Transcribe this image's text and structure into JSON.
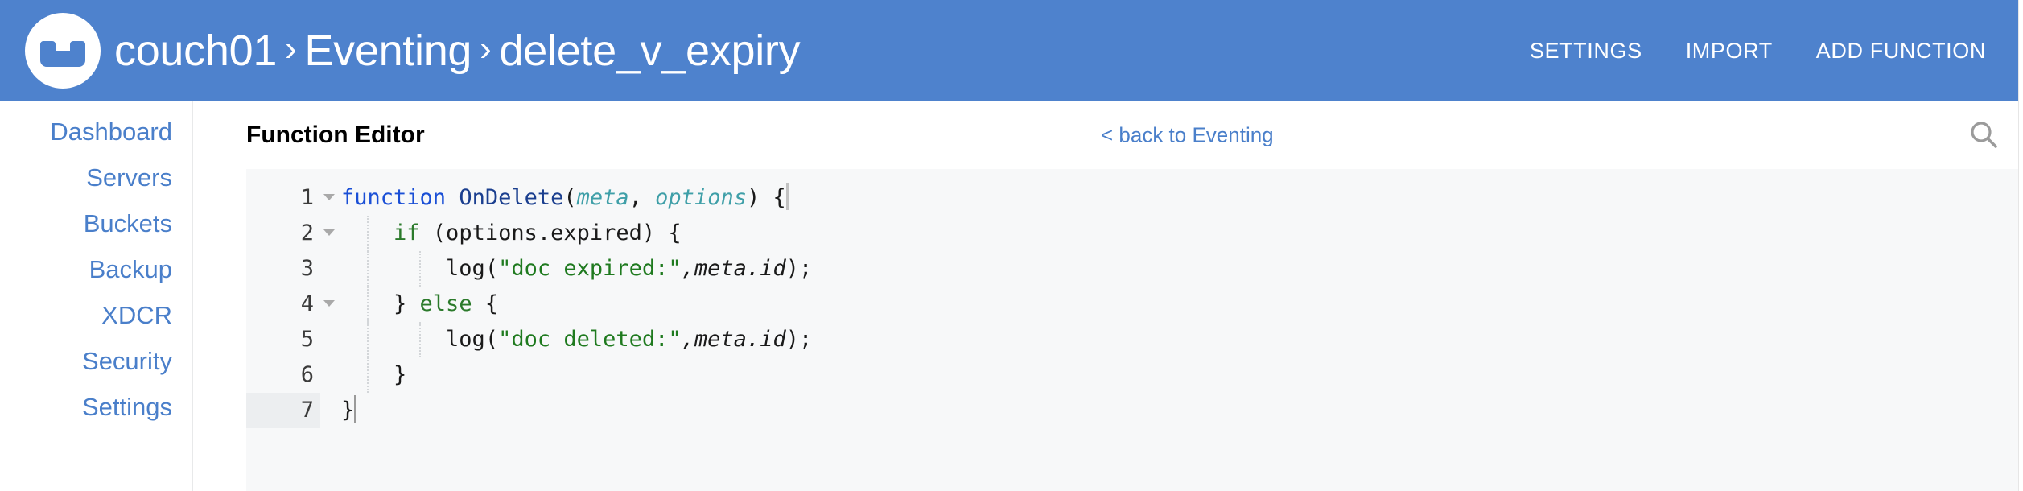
{
  "header": {
    "logo_icon": "couchbase-logo-icon",
    "breadcrumb": {
      "separator": "›",
      "items": [
        "couch01",
        "Eventing",
        "delete_v_expiry"
      ]
    },
    "nav": [
      {
        "label": "SETTINGS",
        "name": "settings"
      },
      {
        "label": "IMPORT",
        "name": "import"
      },
      {
        "label": "ADD FUNCTION",
        "name": "add-function"
      }
    ],
    "bg_color": "#4e82cd",
    "text_color": "#ffffff"
  },
  "sidebar": {
    "items": [
      {
        "label": "Dashboard"
      },
      {
        "label": "Servers"
      },
      {
        "label": "Buckets"
      },
      {
        "label": "Backup"
      },
      {
        "label": "XDCR"
      },
      {
        "label": "Security"
      },
      {
        "label": "Settings"
      }
    ],
    "link_color": "#4a7fca"
  },
  "main": {
    "page_title": "Function Editor",
    "back_link": "< back to Eventing",
    "search_icon": "search-icon"
  },
  "editor": {
    "background": "#f7f8f9",
    "active_line": 7,
    "lines": [
      {
        "num": "1",
        "fold": true,
        "indent": 0
      },
      {
        "num": "2",
        "fold": true,
        "indent": 1
      },
      {
        "num": "3",
        "fold": false,
        "indent": 2
      },
      {
        "num": "4",
        "fold": true,
        "indent": 1
      },
      {
        "num": "5",
        "fold": false,
        "indent": 2
      },
      {
        "num": "6",
        "fold": false,
        "indent": 1
      },
      {
        "num": "7",
        "fold": false,
        "indent": 0
      }
    ],
    "code": {
      "l1_kw": "function",
      "l1_space": " ",
      "l1_name": "OnDelete",
      "l1_paren_open": "(",
      "l1_p1": "meta",
      "l1_comma": ", ",
      "l1_p2": "options",
      "l1_paren_close": ") ",
      "l1_brace": "{",
      "l2_indent": "    ",
      "l2_ctrl": "if",
      "l2_rest": " (options.expired) {",
      "l3_indent": "        ",
      "l3_call": "log(",
      "l3_str": "\"doc expired:\"",
      "l3_arg": ",meta.id",
      "l3_end": ");",
      "l4_indent": "    ",
      "l4_close": "} ",
      "l4_ctrl": "else",
      "l4_brace": " {",
      "l5_indent": "        ",
      "l5_call": "log(",
      "l5_str": "\"doc deleted:\"",
      "l5_arg": ",meta.id",
      "l5_end": ");",
      "l6_indent": "    ",
      "l6_close": "}",
      "l7_close": "}"
    }
  }
}
